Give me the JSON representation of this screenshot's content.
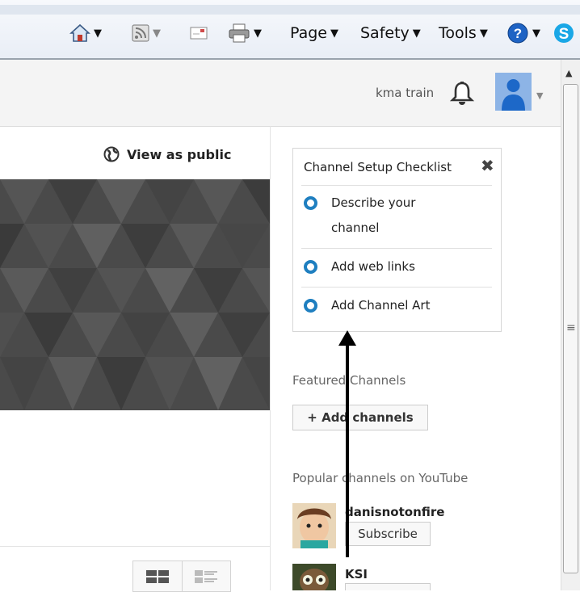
{
  "browser": {
    "commands": {
      "page": "Page",
      "safety": "Safety",
      "tools": "Tools"
    },
    "icons": [
      "home-icon",
      "feeds-icon",
      "read-mail-icon",
      "print-icon",
      "help-icon",
      "skype-icon"
    ]
  },
  "header": {
    "username": "kma train"
  },
  "main": {
    "view_as_public": "View as public"
  },
  "checklist": {
    "title": "Channel Setup Checklist",
    "close": "✖",
    "items": [
      {
        "line1": "Describe your",
        "line2": "channel"
      },
      {
        "line1": "Add web links"
      },
      {
        "line1": "Add Channel Art"
      }
    ]
  },
  "featured": {
    "label": "Featured Channels",
    "add_button": "+ Add channels"
  },
  "popular": {
    "label": "Popular channels on YouTube",
    "channels": [
      {
        "name": "danisnotonfire",
        "subscribe": "Subscribe"
      },
      {
        "name": "KSI"
      }
    ]
  },
  "colors": {
    "accent_ring": "#1f7fc0",
    "avatar_bg": "#8db4e6",
    "banner_bg": "#4a4a4a"
  }
}
